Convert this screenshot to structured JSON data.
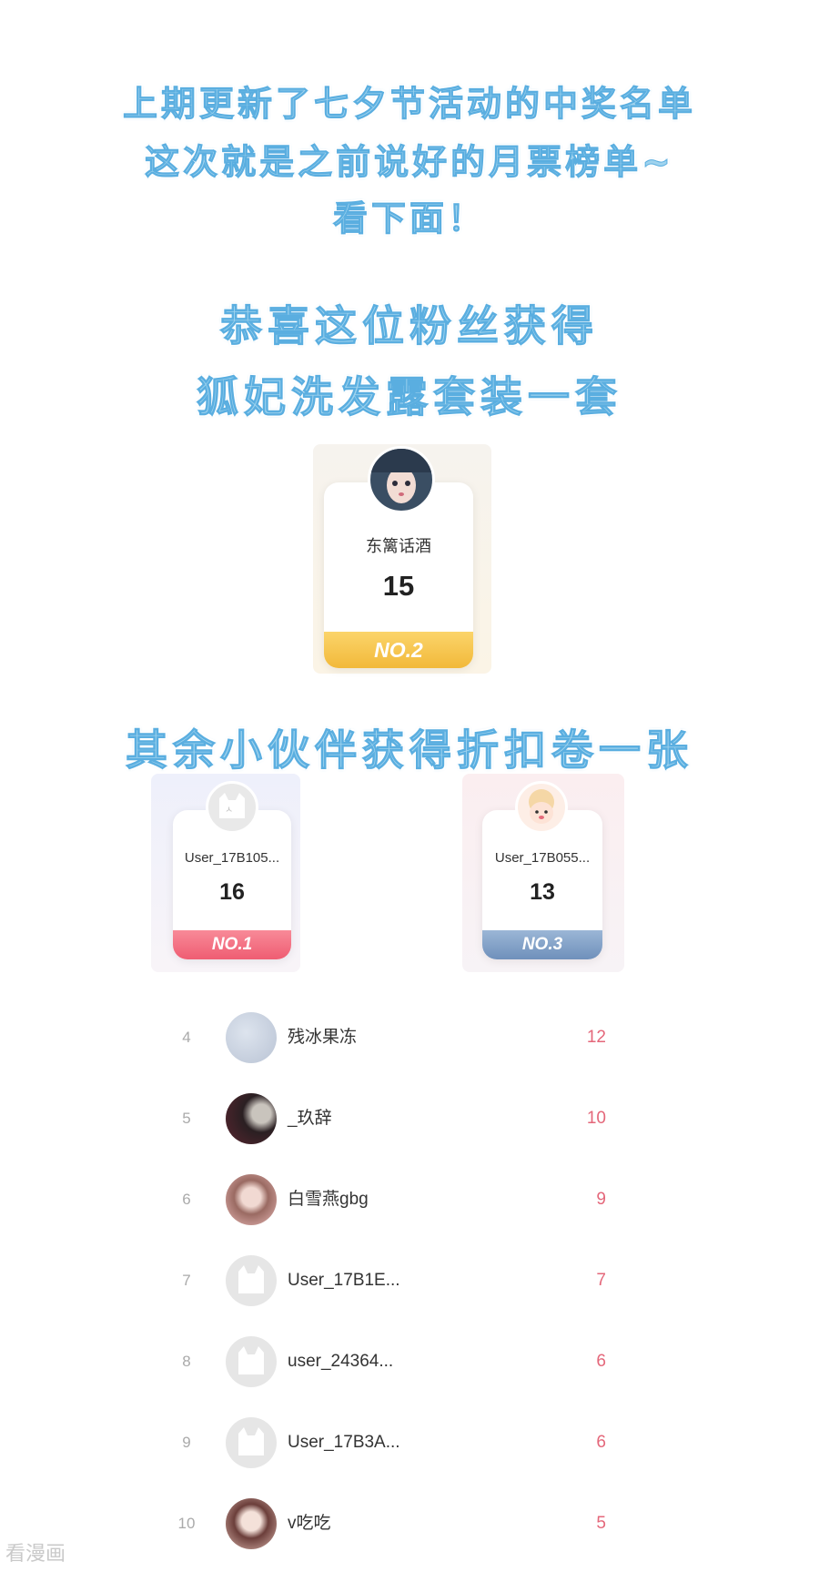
{
  "intro": {
    "line1": "上期更新了七夕节活动的中奖名单",
    "line2": "这次就是之前说好的月票榜单~",
    "line3": "看下面！"
  },
  "prize_main": {
    "line1": "恭喜这位粉丝获得",
    "line2": "狐妃洗发露套装一套"
  },
  "winner": {
    "name": "东篱话酒",
    "score": "15",
    "rank": "NO.2"
  },
  "prize_others": "其余小伙伴获得折扣卷一张",
  "podium": [
    {
      "name": "User_17B105...",
      "score": "16",
      "rank": "NO.1"
    },
    {
      "name": "User_17B055...",
      "score": "13",
      "rank": "NO.3"
    }
  ],
  "list": [
    {
      "rank": "4",
      "name": "残冰果冻",
      "score": "12"
    },
    {
      "rank": "5",
      "name": "_玖辞",
      "score": "10"
    },
    {
      "rank": "6",
      "name": "白雪燕gbg",
      "score": "9"
    },
    {
      "rank": "7",
      "name": "User_17B1E...",
      "score": "7"
    },
    {
      "rank": "8",
      "name": "user_24364...",
      "score": "6"
    },
    {
      "rank": "9",
      "name": "User_17B3A...",
      "score": "6"
    },
    {
      "rank": "10",
      "name": "v吃吃",
      "score": "5"
    }
  ],
  "watermark": "看漫画",
  "colors": {
    "headline": "#9fd3ee",
    "gold": "#f7c948",
    "red": "#f26d80",
    "blue": "#7f9ec4",
    "score_pink": "#e4677a"
  }
}
